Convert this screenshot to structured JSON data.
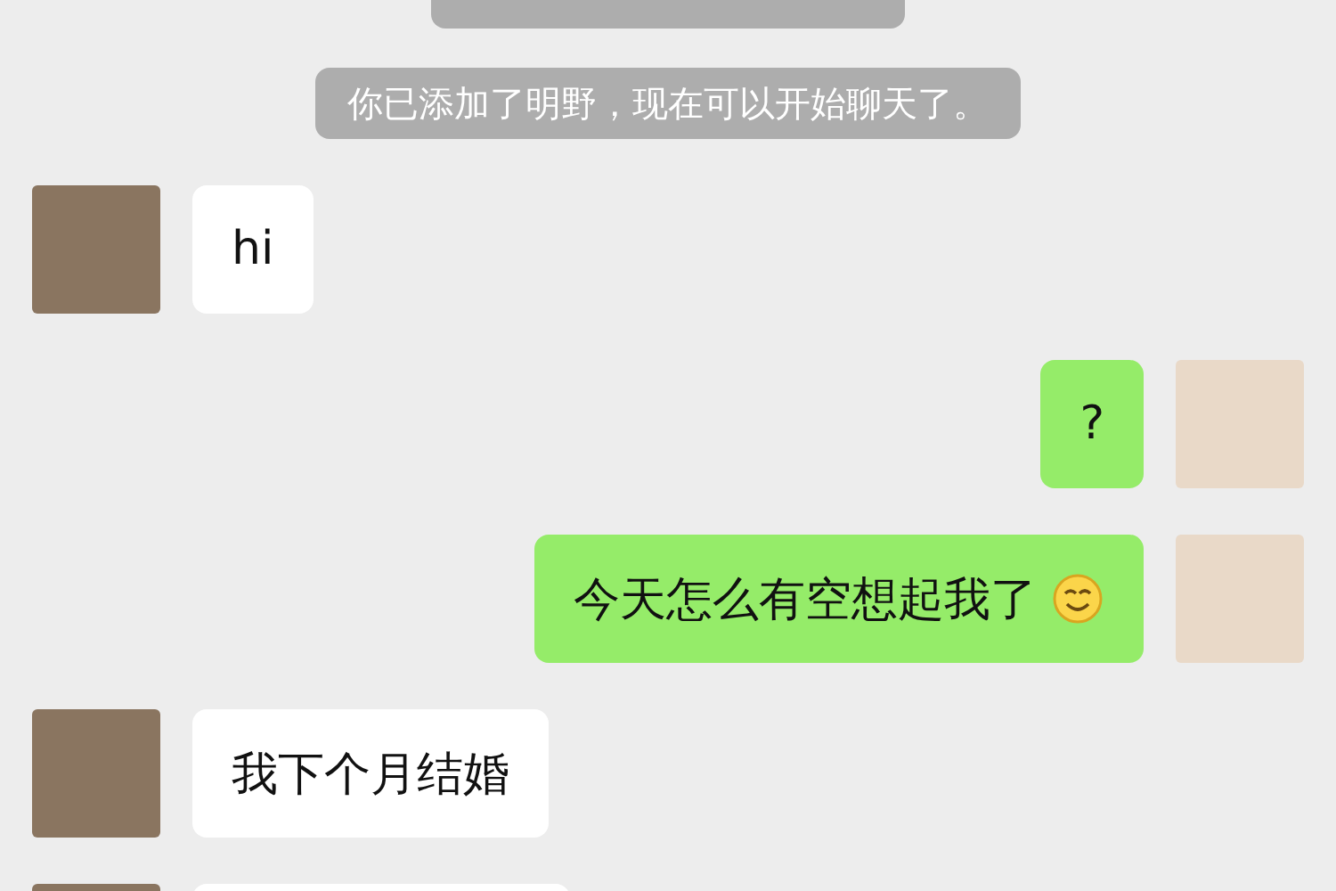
{
  "messages": [
    {
      "kind": "notice"
    },
    {
      "kind": "notice",
      "text": "你已添加了明野，现在可以开始聊天了。"
    },
    {
      "kind": "incoming",
      "text": "hi"
    },
    {
      "kind": "outgoing",
      "text": "?"
    },
    {
      "kind": "outgoing",
      "text": "今天怎么有空想起我了",
      "smiley": true
    },
    {
      "kind": "incoming",
      "text": "我下个月结婚"
    },
    {
      "kind": "incoming"
    }
  ]
}
